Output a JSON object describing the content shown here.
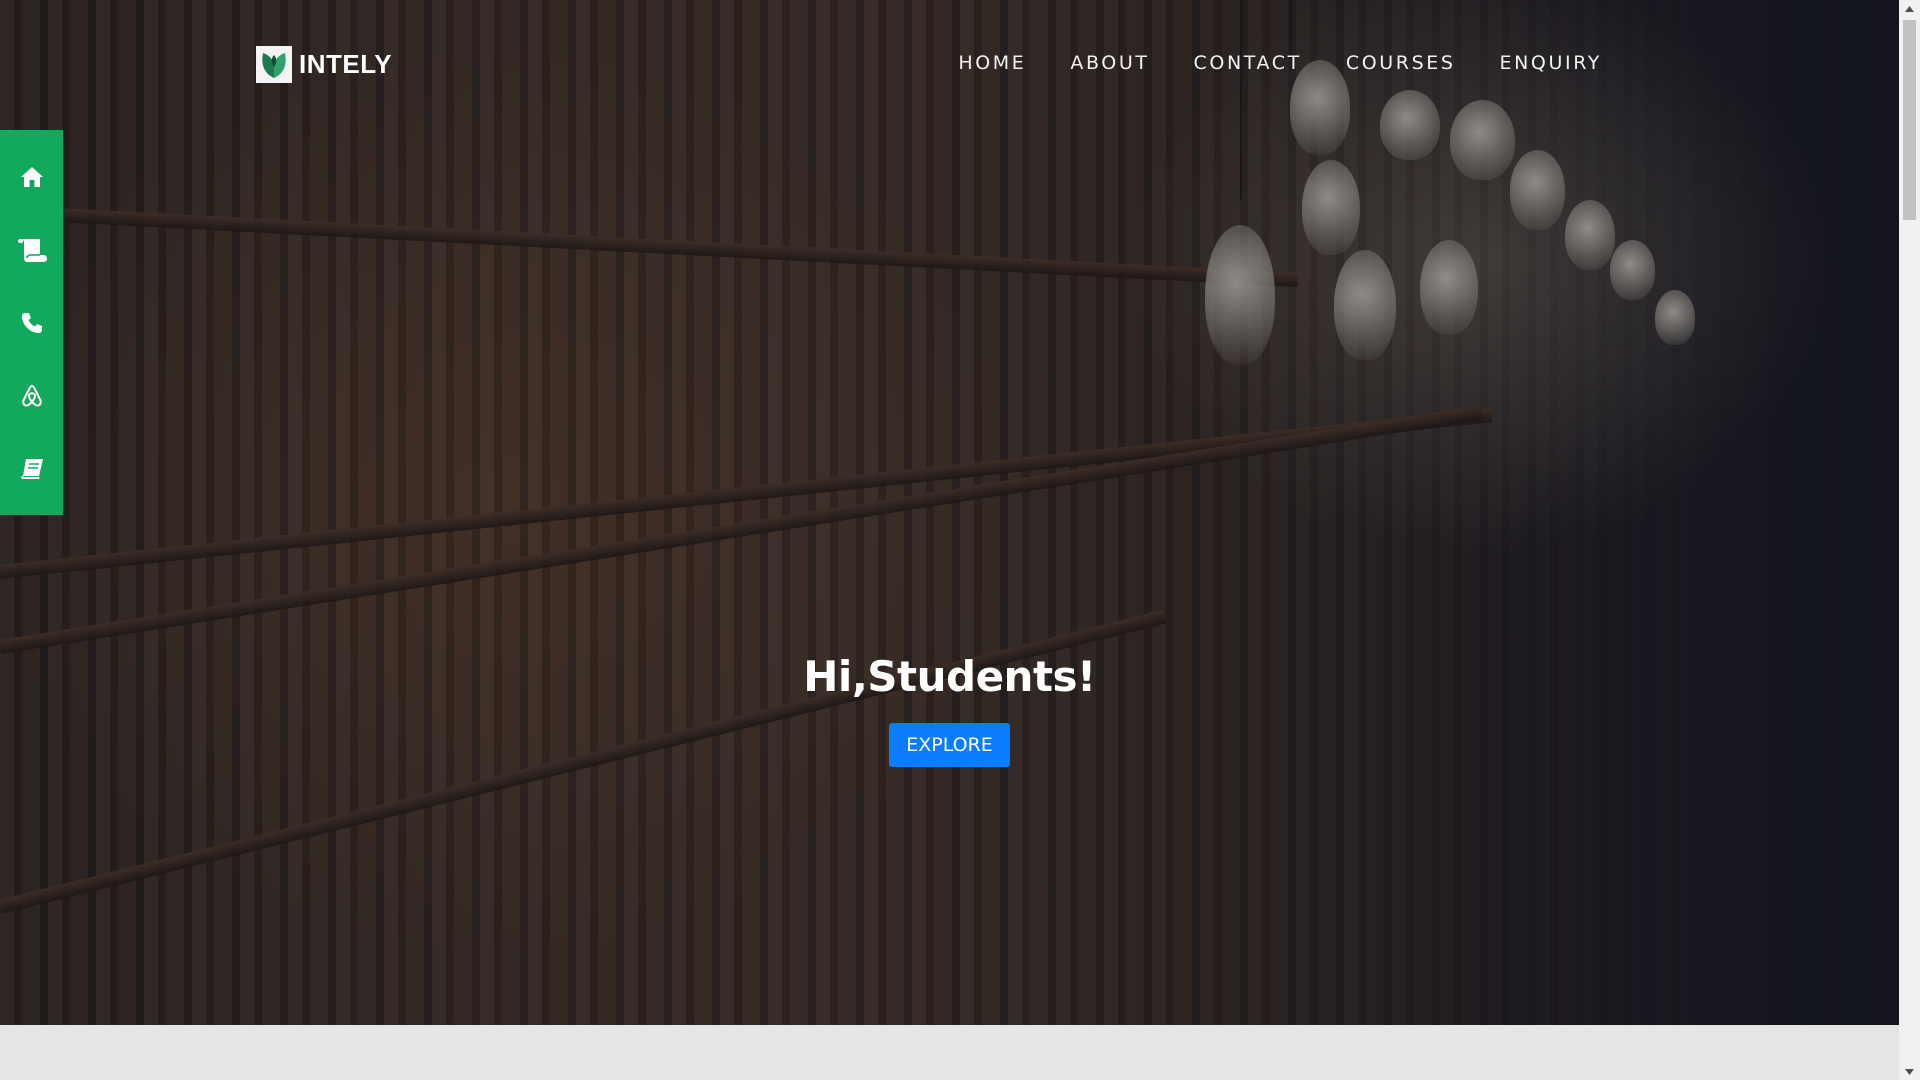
{
  "brand": {
    "name": "INTELY",
    "logo_icon": "leaf-book-logo-icon",
    "accent_color": "#12a95d"
  },
  "nav": {
    "items": [
      {
        "label": "HOME"
      },
      {
        "label": "ABOUT"
      },
      {
        "label": "CONTACT"
      },
      {
        "label": "COURSES"
      },
      {
        "label": "ENQUIRY"
      }
    ]
  },
  "sidebar": {
    "color": "#12a95d",
    "items": [
      {
        "icon": "home-icon"
      },
      {
        "icon": "scroll-icon"
      },
      {
        "icon": "phone-icon"
      },
      {
        "icon": "airbnb-icon"
      },
      {
        "icon": "book-icon"
      }
    ]
  },
  "hero": {
    "title": "Hi,Students!",
    "button_label": "EXPLORE",
    "button_color": "#0a7cff",
    "background": "library-bookshelves-photo"
  }
}
